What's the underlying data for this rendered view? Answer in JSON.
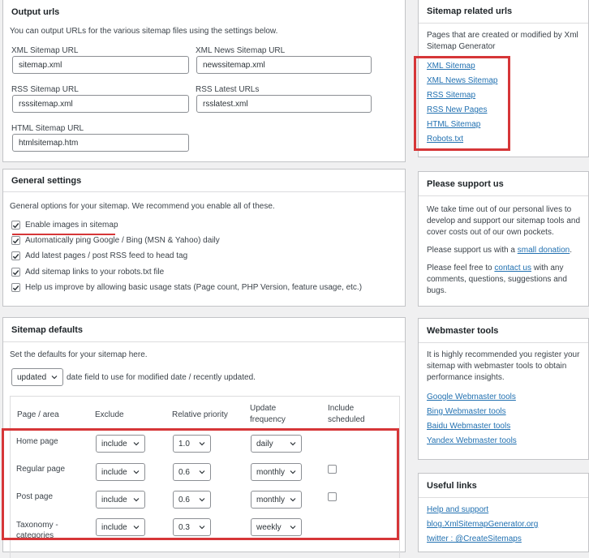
{
  "output_urls": {
    "title": "Output urls",
    "description": "You can output URLs for the various sitemap files using the settings below.",
    "fields": [
      {
        "label": "XML Sitemap URL",
        "value": "sitemap.xml"
      },
      {
        "label": "XML News Sitemap URL",
        "value": "newssitemap.xml"
      },
      {
        "label": "RSS Sitemap URL",
        "value": "rsssitemap.xml"
      },
      {
        "label": "RSS Latest URLs",
        "value": "rsslatest.xml"
      },
      {
        "label": "HTML Sitemap URL",
        "value": "htmlsitemap.htm"
      }
    ]
  },
  "general_settings": {
    "title": "General settings",
    "description": "General options for your sitemap. We recommend you enable all of these.",
    "options": [
      {
        "label": "Enable images in sitemap",
        "checked": true
      },
      {
        "label": "Automatically ping Google / Bing (MSN & Yahoo) daily",
        "checked": true
      },
      {
        "label": "Add latest pages / post RSS feed to head tag",
        "checked": true
      },
      {
        "label": "Add sitemap links to your robots.txt file",
        "checked": true
      },
      {
        "label": "Help us improve by allowing basic usage stats (Page count, PHP Version, feature usage, etc.)",
        "checked": true
      }
    ]
  },
  "sitemap_defaults": {
    "title": "Sitemap defaults",
    "description": "Set the defaults for your sitemap here.",
    "date_select": "updated",
    "date_label": "date field to use for modified date / recently updated.",
    "headers": {
      "page_area": "Page / area",
      "exclude": "Exclude",
      "priority": "Relative priority",
      "frequency_line1": "Update",
      "frequency_line2": "frequency",
      "scheduled_line1": "Include",
      "scheduled_line2": "scheduled"
    },
    "rows": [
      {
        "label_line1": "Home page",
        "label_line2": "",
        "exclude": "include",
        "priority": "1.0",
        "frequency": "daily",
        "scheduled": null
      },
      {
        "label_line1": "Regular page",
        "label_line2": "",
        "exclude": "include",
        "priority": "0.6",
        "frequency": "monthly",
        "scheduled": false
      },
      {
        "label_line1": "Post page",
        "label_line2": "",
        "exclude": "include",
        "priority": "0.6",
        "frequency": "monthly",
        "scheduled": false
      },
      {
        "label_line1": "Taxonomy -",
        "label_line2": "categories",
        "exclude": "include",
        "priority": "0.3",
        "frequency": "weekly",
        "scheduled": null
      }
    ]
  },
  "sidebar": {
    "related": {
      "title": "Sitemap related urls",
      "description": "Pages that are created or modified by Xml Sitemap Generator",
      "links": [
        "XML Sitemap",
        "XML News Sitemap",
        "RSS Sitemap",
        "RSS New Pages",
        "HTML Sitemap",
        "Robots.txt"
      ]
    },
    "support": {
      "title": "Please support us",
      "para1": "We take time out of our personal lives to develop and support our sitemap tools and cover costs out of our own pockets.",
      "para2_before": "Please support us with a",
      "para2_link": "small donation",
      "para2_after": ".",
      "para3_before": "Please feel free to",
      "para3_link": "contact us",
      "para3_after": "with any comments, questions, suggestions and bugs."
    },
    "webmaster": {
      "title": "Webmaster tools",
      "description": "It is highly recommended you register your sitemap with webmaster tools to obtain performance insights.",
      "links": [
        "Google Webmaster tools",
        "Bing Webmaster tools",
        "Baidu Webmaster tools",
        "Yandex Webmaster tools"
      ]
    },
    "useful": {
      "title": "Useful links",
      "links": [
        "Help and support",
        "blog.XmlSitemapGenerator.org",
        "twitter : @CreateSitemaps"
      ]
    }
  },
  "colors": {
    "accent": "#2271b1",
    "highlight": "#d63638"
  }
}
